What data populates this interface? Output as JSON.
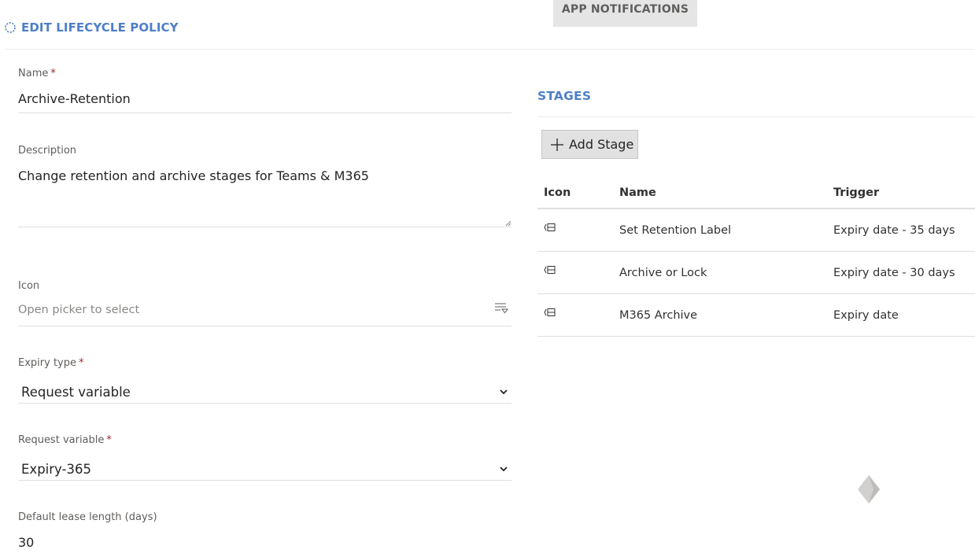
{
  "app_notifications": {
    "label": "APP NOTIFICATIONS"
  },
  "page": {
    "title": "EDIT LIFECYCLE POLICY"
  },
  "form": {
    "name": {
      "label": "Name",
      "required_marker": "*",
      "value": "Archive-Retention"
    },
    "description": {
      "label": "Description",
      "value": "Change retention and archive stages for Teams & M365"
    },
    "icon": {
      "label": "Icon",
      "placeholder": "Open picker to select"
    },
    "expiry_type": {
      "label": "Expiry type",
      "required_marker": "*",
      "value": "Request variable"
    },
    "request_variable": {
      "label": "Request variable",
      "required_marker": "*",
      "value": "Expiry-365"
    },
    "lease_length": {
      "label": "Default lease length (days)",
      "value": "30"
    }
  },
  "stages": {
    "title": "STAGES",
    "add_button_label": "Add Stage",
    "columns": {
      "icon": "Icon",
      "name": "Name",
      "trigger": "Trigger"
    },
    "rows": [
      {
        "icon": "stage-icon",
        "name": "Set Retention Label",
        "trigger": "Expiry date - 35 days"
      },
      {
        "icon": "stage-icon",
        "name": "Archive or Lock",
        "trigger": "Expiry date - 30 days"
      },
      {
        "icon": "stage-icon",
        "name": "M365 Archive",
        "trigger": "Expiry date"
      }
    ]
  },
  "colors": {
    "accent": "#4e7fc8",
    "required": "#a4262c",
    "button_bg": "#e1e1e1"
  }
}
